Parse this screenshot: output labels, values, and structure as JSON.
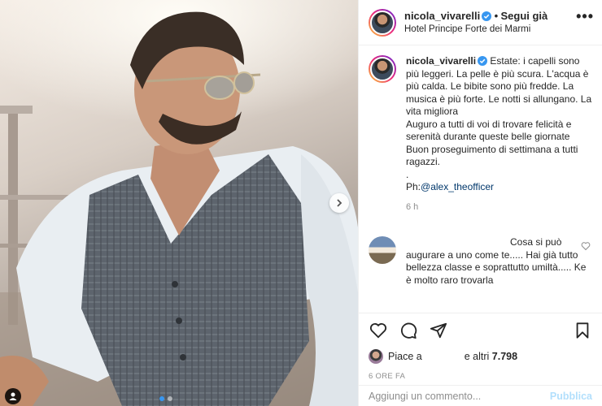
{
  "header": {
    "username": "nicola_vivarelli",
    "separator": "•",
    "follow_label": "Segui già",
    "location": "Hotel Principe Forte dei Marmi",
    "more_label": "•••"
  },
  "caption": {
    "username": "nicola_vivarelli",
    "lines": [
      "Estate: i capelli sono più leggeri. La pelle è più scura. L'acqua è più calda. Le bibite sono più fredde. La musica è più forte. Le notti si allungano. La vita migliora",
      "Auguro a tutti di voi di trovare felicità e serenità durante queste belle giornate",
      "Buon proseguimento di settimana a tutti ragazzi.",
      "."
    ],
    "credit_prefix": "Ph:",
    "credit_mention": "@alex_theofficer",
    "age": "6 h"
  },
  "comment": {
    "text": "Cosa si può augurare a uno come te..... Hai già tutto bellezza classe e soprattutto umiltà..... Ke è molto raro trovarla"
  },
  "likes": {
    "prefix": "Piace a",
    "suffix": "e altri",
    "count": "7.798"
  },
  "timestamp": "6 ORE FA",
  "add_comment": {
    "placeholder": "Aggiungi un commento...",
    "publish_label": "Pubblica"
  },
  "carousel": {
    "count": 2,
    "active_index": 0
  },
  "colors": {
    "link": "#00376b",
    "verified": "#3897f0",
    "publish_disabled": "#b2dffc",
    "muted": "#8e8e8e"
  },
  "icons": [
    "verified-badge-icon",
    "more-icon",
    "heart-icon",
    "comment-icon",
    "share-icon",
    "bookmark-icon",
    "chevron-right-icon",
    "user-tag-icon"
  ]
}
